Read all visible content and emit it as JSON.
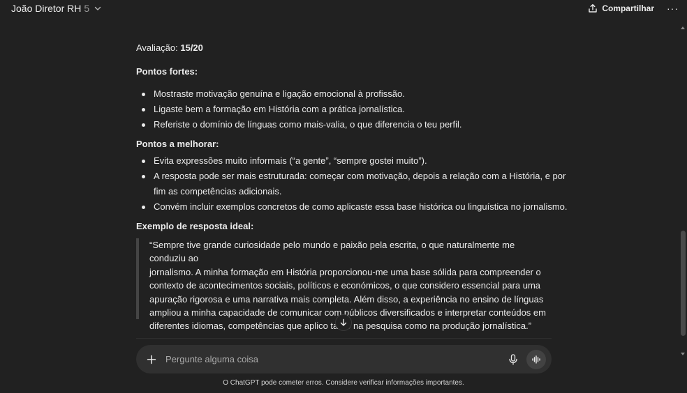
{
  "header": {
    "model_name": "João Diretor RH",
    "model_version": "5",
    "share_label": "Compartilhar",
    "more_label": "···"
  },
  "message": {
    "evaluation_label": "Avaliação: ",
    "evaluation_value": "15/20",
    "strengths_heading": "Pontos fortes:",
    "strengths": [
      "Mostraste motivação genuína e ligação emocional à profissão.",
      "Ligaste bem a formação em História com a prática jornalística.",
      "Referiste o domínio de línguas como mais-valia, o que diferencia o teu perfil."
    ],
    "improve_heading": "Pontos a melhorar:",
    "improvements": [
      "Evita expressões muito informais (“a gente”, “sempre gostei muito”).",
      "A resposta pode ser mais estruturada: começar com motivação, depois a relação com a História, e por",
      "fim as competências adicionais.",
      "Convém incluir exemplos concretos de como aplicaste essa base histórica ou linguística no jornalismo."
    ],
    "example_heading": "Exemplo de resposta ideal:",
    "example_lines": [
      "“Sempre tive grande curiosidade pelo mundo e paixão pela escrita, o que naturalmente me conduziu ao",
      "jornalismo. A minha formação em História proporcionou-me uma base sólida para compreender o",
      "contexto de acontecimentos sociais, políticos e económicos, o que considero essencial para uma",
      "apuração rigorosa e uma narrativa mais completa. Além disso, a experiência no ensino de línguas",
      "ampliou a minha capacidade de comunicar com públicos diversificados e interpretar conteúdos em",
      "diferentes idiomas, competências que aplico tanto na pesquisa como na produção jornalística.”"
    ]
  },
  "composer": {
    "placeholder": "Pergunte alguma coisa"
  },
  "footer": {
    "note": "O ChatGPT pode cometer erros. Considere verificar informações importantes."
  }
}
